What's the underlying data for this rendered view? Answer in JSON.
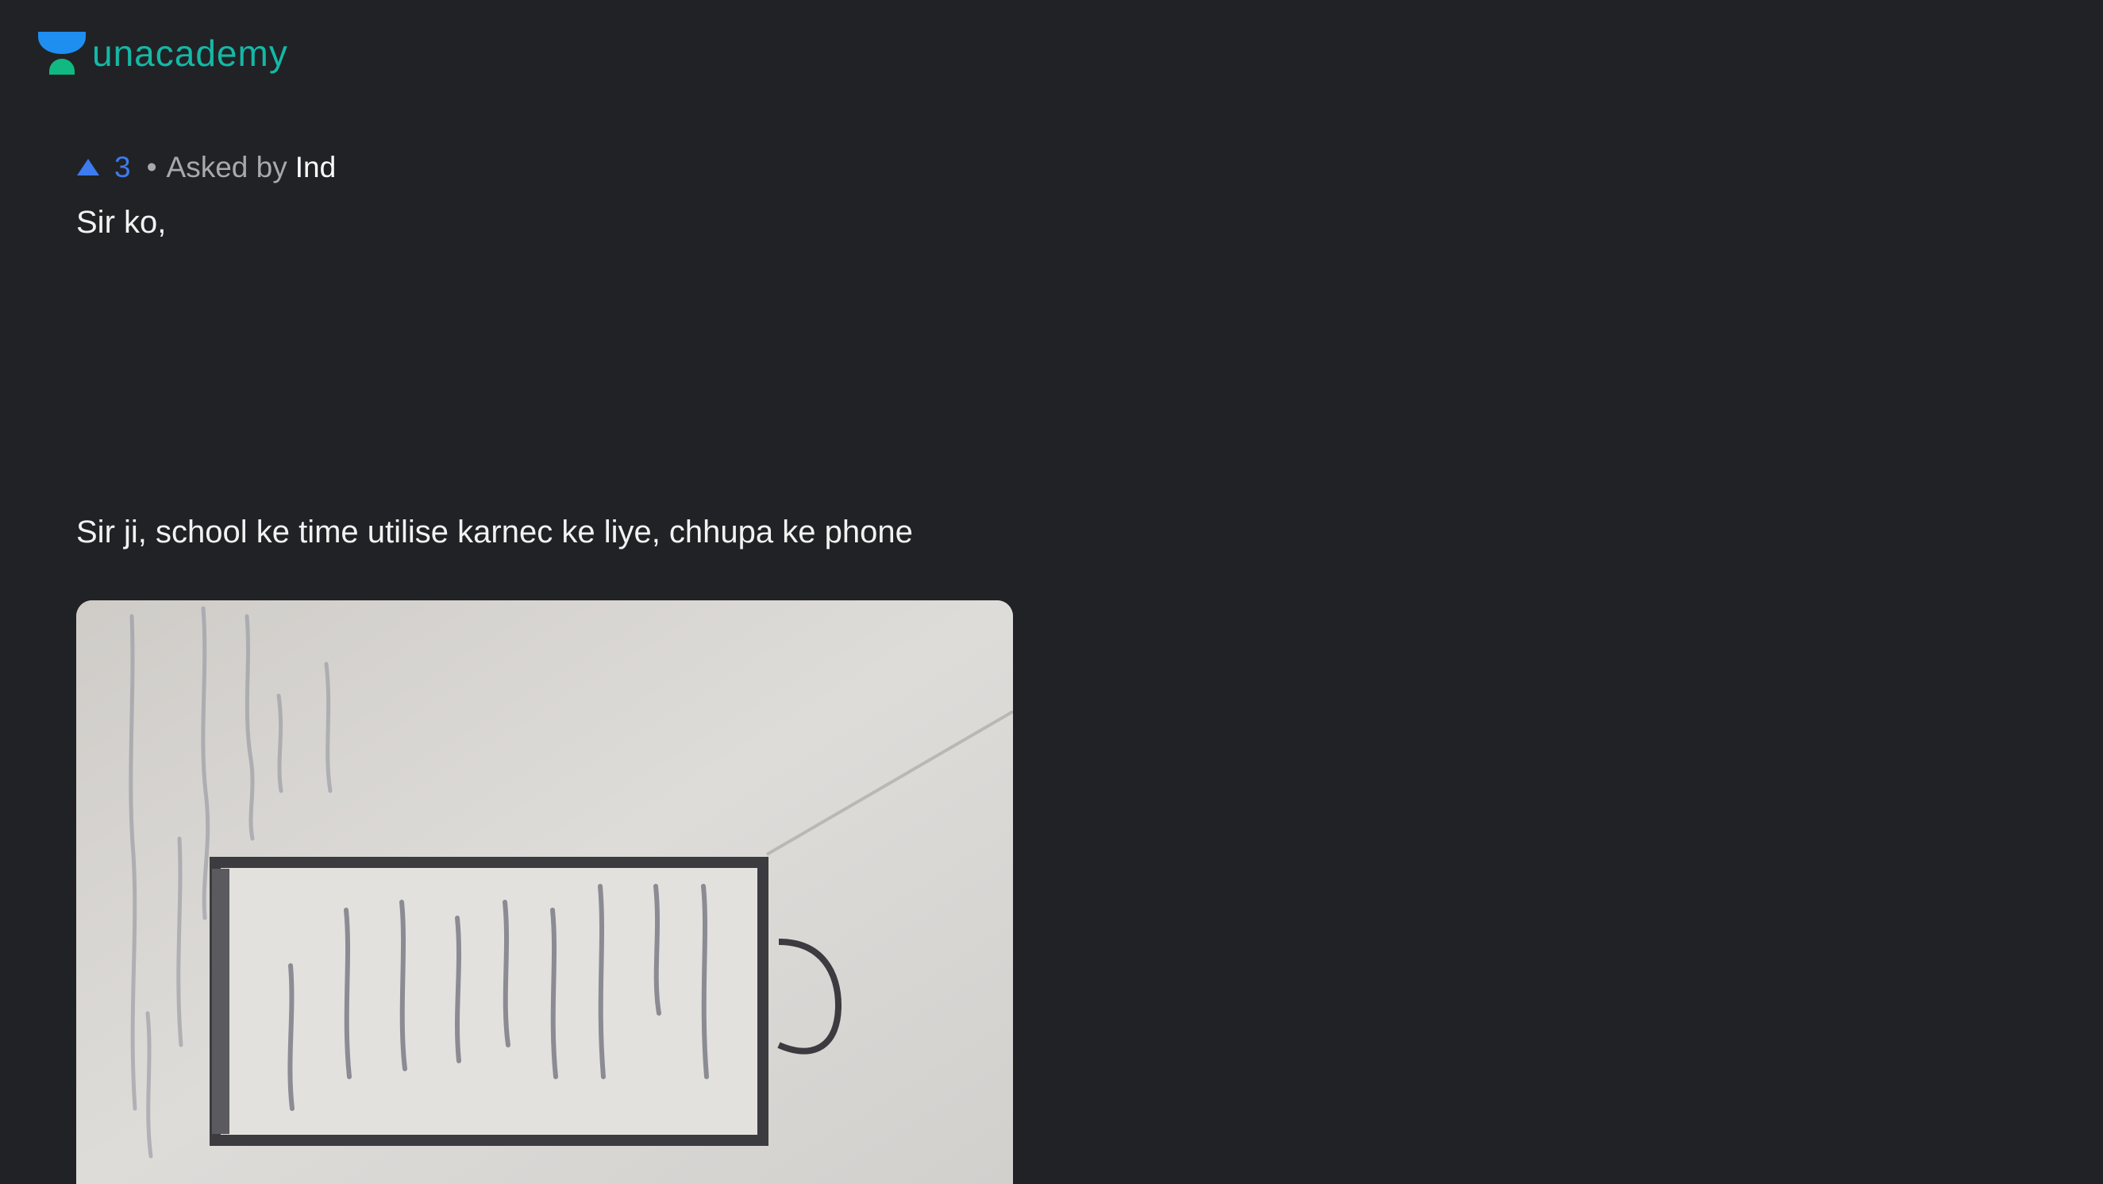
{
  "brand": {
    "name": "unacademy",
    "colors": {
      "logo_top": "#1f8ef1",
      "logo_bottom": "#10b981",
      "text": "#14b8a6"
    }
  },
  "question": {
    "upvotes": "3",
    "separator": "•",
    "asked_by_label": "Asked by",
    "asker": "Ind",
    "text_line_1": "Sir ko,",
    "text_line_2": "Sir ji, school ke time utilise karnec ke liye, chhupa ke phone",
    "image": {
      "description_icon": "photo-of-handwritten-notes"
    }
  },
  "colors": {
    "background": "#212225",
    "upvote_accent": "#3c7bf0"
  }
}
